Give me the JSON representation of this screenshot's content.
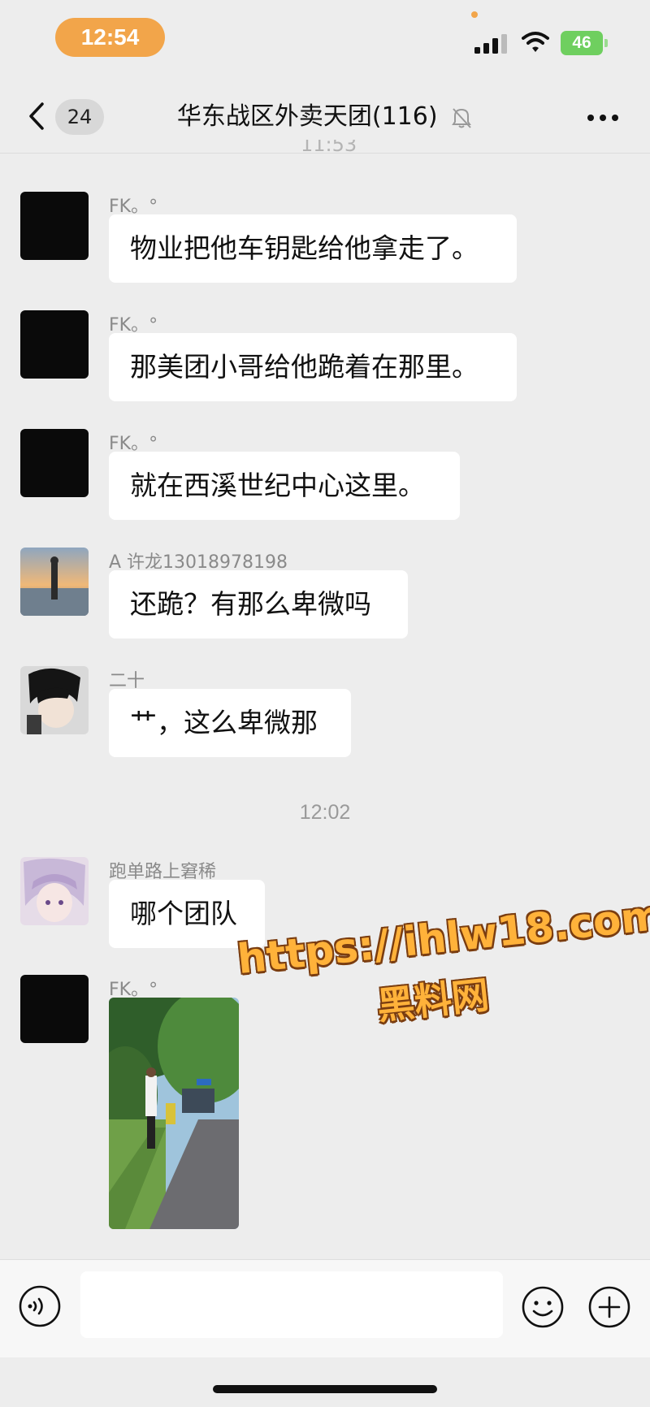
{
  "status_bar": {
    "time": "12:54",
    "battery": "46"
  },
  "nav": {
    "back_count": "24",
    "title": "华东战区外卖天团(116)"
  },
  "previous_time": "11:53",
  "messages": [
    {
      "sender": "FK。°",
      "text": "物业把他车钥匙给他拿走了。"
    },
    {
      "sender": "FK。°",
      "text": "那美团小哥给他跪着在那里。"
    },
    {
      "sender": "FK。°",
      "text": "就在西溪世纪中心这里。"
    },
    {
      "sender": "A 许龙13018978198",
      "text": "还跪？有那么卑微吗"
    },
    {
      "sender": "二十",
      "text": "艹，这么卑微那"
    },
    {
      "sender": "跑单路上窘稀",
      "text": "哪个团队"
    },
    {
      "sender": "FK。°"
    }
  ],
  "time_separator": "12:02",
  "watermark": {
    "url": "https://ihlw18.com",
    "text": "黑料网"
  },
  "input": {
    "placeholder": ""
  },
  "icons": {
    "back": "chevron-left-icon",
    "mute": "bell-slash-icon",
    "more": "more-dots-icon",
    "voice": "voice-icon",
    "emoji": "emoji-icon",
    "plus": "plus-icon"
  },
  "colors": {
    "accent": "#f2a54a",
    "bubble": "#ffffff",
    "background": "#ededed",
    "battery": "#6fcf5f"
  }
}
